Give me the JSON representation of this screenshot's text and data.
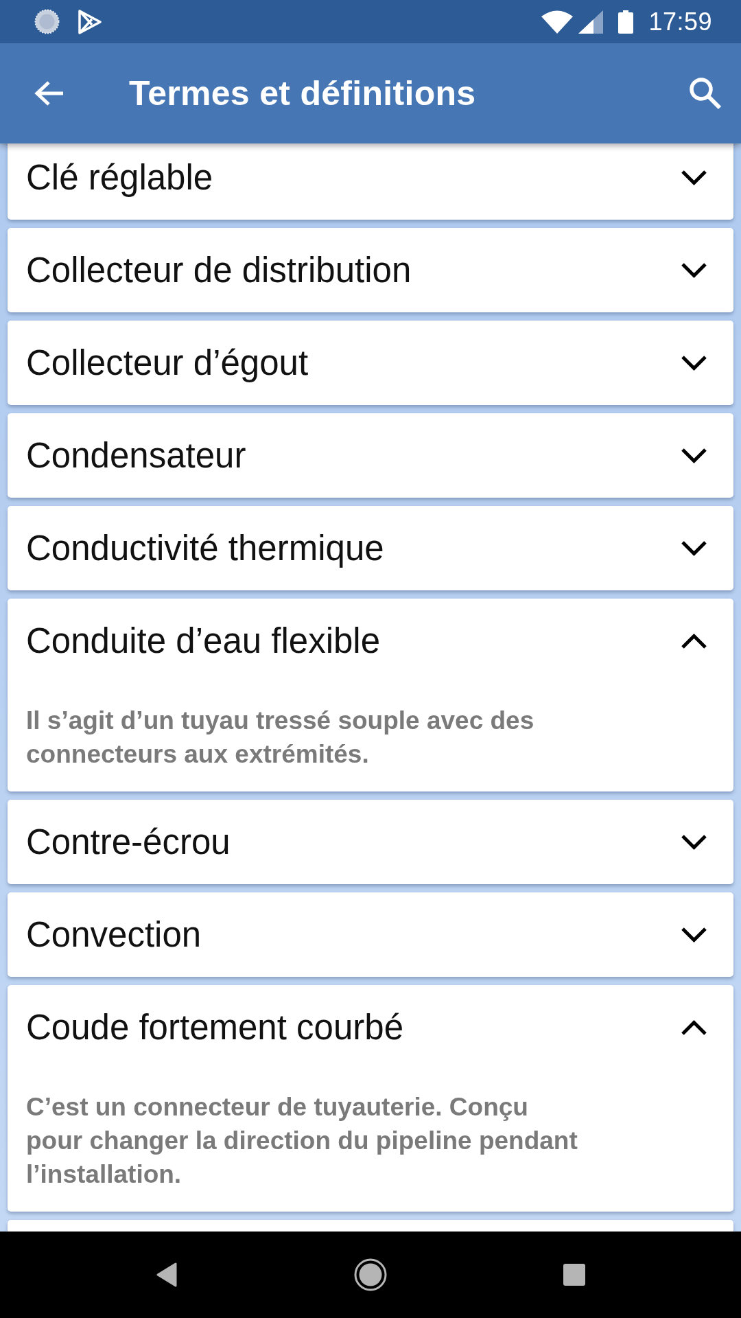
{
  "status_bar": {
    "time": "17:59"
  },
  "app_bar": {
    "title": "Termes et définitions"
  },
  "terms": [
    {
      "term": "Clé réglable",
      "expanded": false
    },
    {
      "term": "Collecteur de distribution",
      "expanded": false
    },
    {
      "term": "Collecteur d’égout",
      "expanded": false
    },
    {
      "term": "Condensateur",
      "expanded": false
    },
    {
      "term": "Conductivité thermique",
      "expanded": false
    },
    {
      "term": "Conduite d’eau flexible",
      "expanded": true,
      "definition": "Il s’agit d’un tuyau tressé souple avec des connecteurs aux extrémités."
    },
    {
      "term": "Contre-écrou",
      "expanded": false
    },
    {
      "term": "Convection",
      "expanded": false
    },
    {
      "term": "Coude fortement courbé",
      "expanded": true,
      "definition": "C’est un connecteur de tuyauterie. Conçu pour changer la direction du pipeline pendant l’installation."
    }
  ]
}
